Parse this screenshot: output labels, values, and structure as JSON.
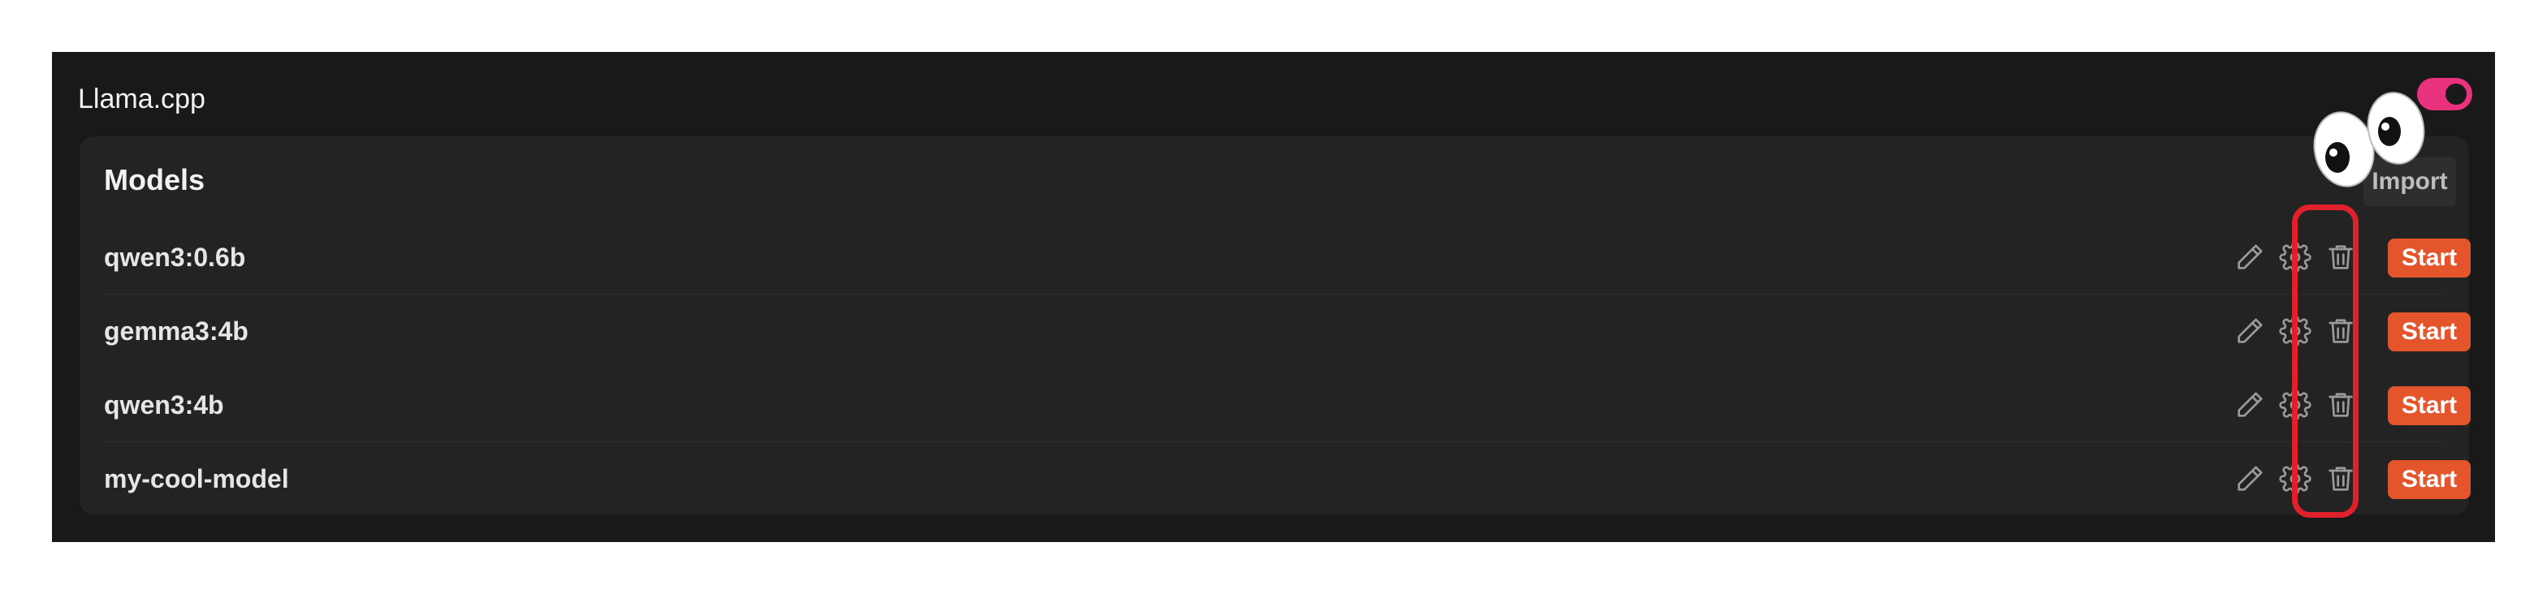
{
  "provider": {
    "title": "Llama.cpp",
    "enabled": true,
    "toggle_color": "#e8327e"
  },
  "models_section": {
    "title": "Models",
    "import_label": "Import",
    "models": [
      {
        "name": "qwen3:0.6b",
        "start_label": "Start"
      },
      {
        "name": "gemma3:4b",
        "start_label": "Start"
      },
      {
        "name": "qwen3:4b",
        "start_label": "Start"
      },
      {
        "name": "my-cool-model",
        "start_label": "Start"
      }
    ],
    "row_icons": [
      "pencil-icon",
      "gear-icon",
      "trash-icon"
    ]
  },
  "annotation": {
    "highlight_color": "#e0202a",
    "sticker": "googly-eyes"
  },
  "colors": {
    "background": "#191919",
    "card": "#232323",
    "start_button": "#e5552b"
  }
}
